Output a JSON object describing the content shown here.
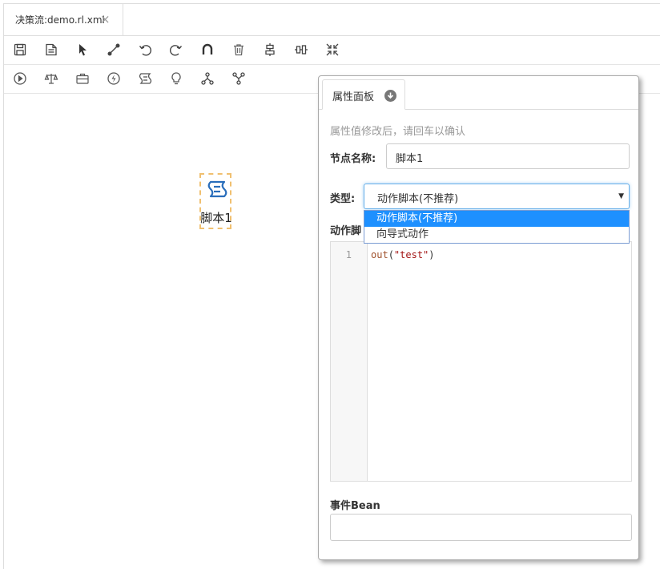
{
  "tab": {
    "title": "决策流:demo.rl.xml",
    "close": "×"
  },
  "toolbar1": [
    "save-icon",
    "save-as-icon",
    "pointer-icon",
    "connection-icon",
    "undo-icon",
    "redo-icon",
    "magnet-icon",
    "delete-icon",
    "align-center-icon",
    "align-middle-icon",
    "collapse-icon"
  ],
  "toolbar2": [
    "start-node-icon",
    "rule-node-icon",
    "package-node-icon",
    "action-node-icon",
    "script-node-icon",
    "idea-node-icon",
    "fork-node-icon",
    "join-node-icon"
  ],
  "node": {
    "label": "脚本1",
    "icon": "script-icon"
  },
  "panel": {
    "tab_label": "属性面板",
    "hint": "属性值修改后，请回车以确认",
    "name_label": "节点名称:",
    "name_value": "脚本1",
    "type_label": "类型:",
    "type_value": "动作脚本(不推荐)",
    "type_options": [
      "动作脚本(不推荐)",
      "向导式动作"
    ],
    "script_label": "动作脚",
    "editor": {
      "line_number": "1",
      "code_func": "out",
      "code_open": "(",
      "code_string": "\"test\"",
      "code_close": ")"
    },
    "bean_label": "事件Bean",
    "bean_value": ""
  },
  "colors": {
    "accent": "#1e90ff",
    "node_border": "#f0c070",
    "node_icon": "#2a6ebb"
  }
}
